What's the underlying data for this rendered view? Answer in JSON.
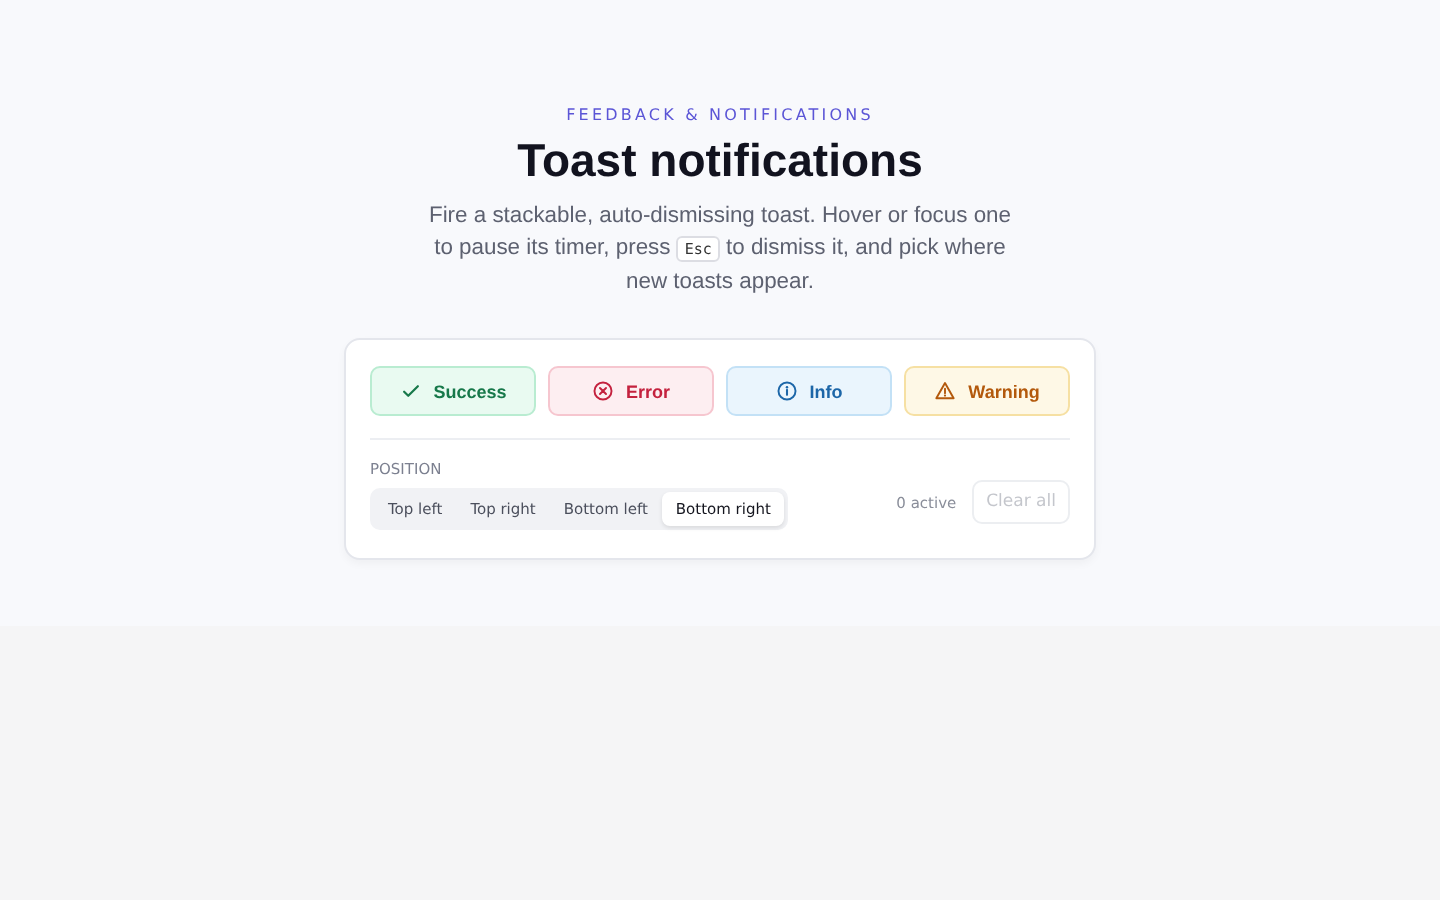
{
  "eyebrow": "FEEDBACK & NOTIFICATIONS",
  "title": "Toast notifications",
  "description": {
    "before": "Fire a stackable, auto-dismissing toast. Hover or focus one to pause its timer, press",
    "key": "Esc",
    "after": "to dismiss it, and pick where new toasts appear."
  },
  "toast_buttons": [
    {
      "kind": "success",
      "label": "Success"
    },
    {
      "kind": "error",
      "label": "Error"
    },
    {
      "kind": "info",
      "label": "Info"
    },
    {
      "kind": "warning",
      "label": "Warning"
    }
  ],
  "position": {
    "label": "POSITION",
    "options": [
      {
        "label": "Top left",
        "selected": false
      },
      {
        "label": "Top right",
        "selected": false
      },
      {
        "label": "Bottom left",
        "selected": false
      },
      {
        "label": "Bottom right",
        "selected": true
      }
    ]
  },
  "active_count": "0 active",
  "clear_button": {
    "label": "Clear all",
    "disabled": true
  }
}
